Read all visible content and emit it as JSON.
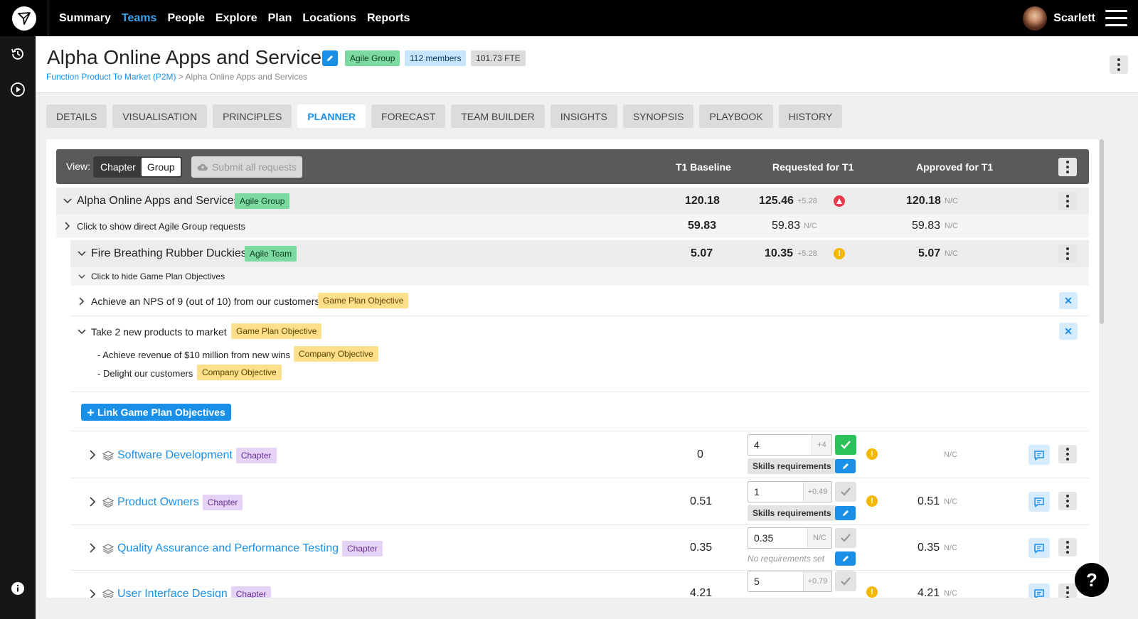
{
  "nav": {
    "items": [
      "Summary",
      "Teams",
      "People",
      "Explore",
      "Plan",
      "Locations",
      "Reports"
    ],
    "active": "Teams",
    "user_name": "Scarlett"
  },
  "header": {
    "title": "Alpha Online Apps and Services",
    "badge_group": "Agile Group",
    "badge_members": "112 members",
    "badge_fte": "101.73 FTE",
    "breadcrumb_link": "Function Product To Market (P2M)",
    "breadcrumb_sep": ">",
    "breadcrumb_current": "Alpha Online Apps and Services"
  },
  "tabs": [
    "DETAILS",
    "VISUALISATION",
    "PRINCIPLES",
    "PLANNER",
    "FORECAST",
    "TEAM BUILDER",
    "INSIGHTS",
    "SYNOPSIS",
    "PLAYBOOK",
    "HISTORY"
  ],
  "viewbar": {
    "view_label": "View:",
    "opt_chapter": "Chapter",
    "opt_group": "Group",
    "submit_label": "Submit all requests",
    "col_baseline": "T1 Baseline",
    "col_requested": "Requested for T1",
    "col_approved": "Approved for T1"
  },
  "group": {
    "name": "Alpha Online Apps and Services",
    "badge": "Agile Group",
    "baseline": "120.18",
    "requested": "125.46",
    "requested_delta": "+5.28",
    "approved": "120.18",
    "approved_status": "N/C"
  },
  "direct": {
    "label": "Click to show direct Agile Group requests",
    "baseline": "59.83",
    "requested": "59.83",
    "requested_status": "N/C",
    "approved": "59.83",
    "approved_status": "N/C"
  },
  "team": {
    "name": "Fire Breathing Rubber Duckies",
    "badge": "Agile Team",
    "baseline": "5.07",
    "requested": "10.35",
    "requested_delta": "+5.28",
    "approved": "5.07",
    "approved_status": "N/C"
  },
  "objectives": {
    "toggle_label": "Click to hide Game Plan Objectives",
    "o1": {
      "text": "Achieve an NPS of 9 (out of 10) from our customers",
      "badge": "Game Plan Objective"
    },
    "o2": {
      "text": "Take 2 new products to market",
      "badge": "Game Plan Objective"
    },
    "c1": {
      "text": "- Achieve revenue of $10 million from new wins",
      "badge": "Company Objective"
    },
    "c2": {
      "text": "- Delight our customers",
      "badge": "Company Objective"
    },
    "link_label": "Link Game Plan Objectives"
  },
  "chapters": [
    {
      "name": "Software Development",
      "badge": "Chapter",
      "baseline": "0",
      "input": "4",
      "delta": "+4",
      "sub": "Skills requirements",
      "approved": "",
      "approved_status": "N/C"
    },
    {
      "name": "Product Owners",
      "badge": "Chapter",
      "baseline": "0.51",
      "input": "1",
      "delta": "+0.49",
      "sub": "Skills requirements",
      "approved": "0.51",
      "approved_status": "N/C"
    },
    {
      "name": "Quality Assurance and Performance Testing",
      "badge": "Chapter",
      "baseline": "0.35",
      "input": "0.35",
      "delta": "N/C",
      "sub": "No requirements set",
      "approved": "0.35",
      "approved_status": "N/C"
    },
    {
      "name": "User Interface Design",
      "badge": "Chapter",
      "baseline": "4.21",
      "input": "5",
      "delta": "+0.79",
      "approved": "4.21",
      "approved_status": "N/C"
    }
  ],
  "help_label": "?",
  "colors": {
    "accent": "#1a8fe8",
    "topbar": "#000000",
    "green_badge": "#7cd9a0",
    "yellow_badge": "#ffe08a",
    "purple_badge": "#e5d3f5"
  }
}
